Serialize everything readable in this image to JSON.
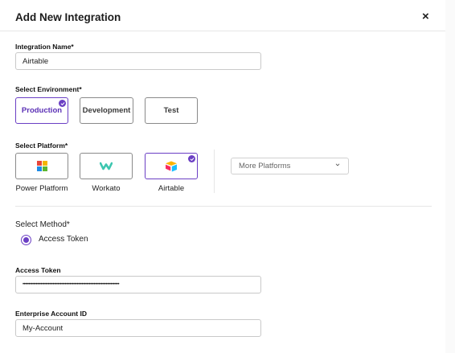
{
  "dialog": {
    "title": "Add New Integration",
    "close_label": "×"
  },
  "integration_name": {
    "label": "Integration Name*",
    "value": "Airtable"
  },
  "environment": {
    "label": "Select Environment*",
    "options": [
      "Production",
      "Development",
      "Test"
    ],
    "selected": "Production"
  },
  "platform": {
    "label": "Select Platform*",
    "options": [
      {
        "label": "Power Platform",
        "icon": "power-platform-icon"
      },
      {
        "label": "Workato",
        "icon": "workato-icon"
      },
      {
        "label": "Airtable",
        "icon": "airtable-icon"
      }
    ],
    "selected": "Airtable",
    "more_label": "More Platforms"
  },
  "method": {
    "label": "Select Method*",
    "option_label": "Access Token"
  },
  "access_token": {
    "label": "Access Token",
    "value": "••••••••••••••••••••••••••••••••••••••••••••••••••••••••••••••••••••••••••••••••"
  },
  "account_id": {
    "label": "Enterprise Account ID",
    "value": "My-Account"
  },
  "colors": {
    "accent": "#6b3fc4",
    "border": "#8a8a8a",
    "divider": "#e6e6e6"
  }
}
